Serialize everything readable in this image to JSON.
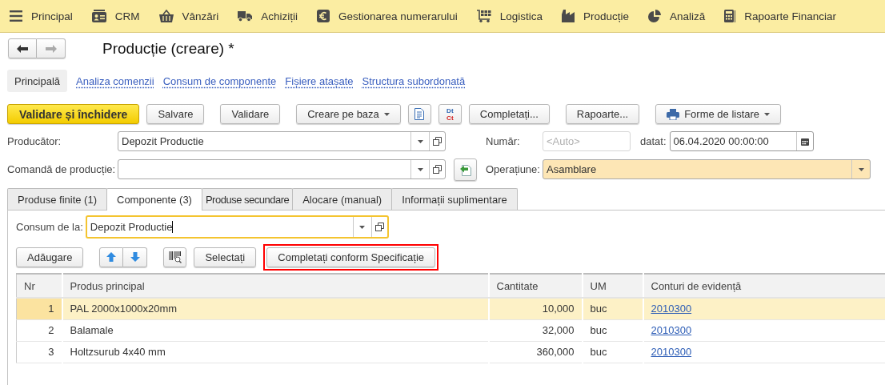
{
  "top_menu": [
    {
      "label": "Principal"
    },
    {
      "label": "CRM"
    },
    {
      "label": "Vânzări"
    },
    {
      "label": "Achiziții"
    },
    {
      "label": "Gestionarea numerarului"
    },
    {
      "label": "Logistica"
    },
    {
      "label": "Producție"
    },
    {
      "label": "Analiză"
    },
    {
      "label": "Rapoarte Financiar"
    }
  ],
  "window": {
    "title": "Producție (creare) *"
  },
  "sections": [
    {
      "label": "Principală",
      "selected": true
    },
    {
      "label": "Analiza comenzii",
      "selected": false
    },
    {
      "label": "Consum de componente",
      "selected": false
    },
    {
      "label": "Fișiere atașate",
      "selected": false
    },
    {
      "label": "Structura subordonată",
      "selected": false
    }
  ],
  "toolbar": [
    {
      "kind": "primary",
      "label": "Validare și închidere"
    },
    {
      "kind": "button",
      "label": "Salvare"
    },
    {
      "kind": "button",
      "label": "Validare"
    },
    {
      "kind": "menu",
      "label": "Creare pe baza"
    },
    {
      "kind": "report"
    },
    {
      "kind": "dtct",
      "labels": [
        "Dt",
        "Ct"
      ]
    },
    {
      "kind": "button",
      "label": "Completați..."
    },
    {
      "kind": "button",
      "label": "Rapoarte..."
    },
    {
      "kind": "print-menu",
      "label": "Forme de listare"
    }
  ],
  "producer": {
    "label": "Producător:",
    "value": "Depozit Productie"
  },
  "number": {
    "label": "Număr:",
    "placeholder": "<Auto>"
  },
  "date": {
    "label": "datat:",
    "value": "06.04.2020 00:00:00"
  },
  "order": {
    "label": "Comandă de producție:"
  },
  "operation": {
    "label": "Operațiune:",
    "value": "Asamblare"
  },
  "tabs": [
    {
      "label": "Produse finite (1)",
      "selected": false
    },
    {
      "label": "Componente (3)",
      "selected": true
    },
    {
      "label": "Produse secundare",
      "selected": false
    },
    {
      "label": "Alocare (manual)",
      "selected": false
    },
    {
      "label": "Informații suplimentare",
      "selected": false
    }
  ],
  "consumption": {
    "label": "Consum de la:",
    "value": "Depozit Productie",
    "focused": true
  },
  "table_toolbar": [
    {
      "kind": "button",
      "label": "Adăugare",
      "highlighted": false
    },
    {
      "kind": "arrows",
      "highlighted": false
    },
    {
      "kind": "barcode",
      "highlighted": false
    },
    {
      "kind": "button",
      "label": "Selectați",
      "highlighted": false
    },
    {
      "kind": "button",
      "label": "Completați conform Specificație",
      "highlighted": true
    }
  ],
  "table": {
    "columns": [
      "Nr",
      "Produs principal",
      "Cantitate",
      "UM",
      "Conturi de evidență"
    ],
    "rows": [
      {
        "nr": "1",
        "product": "PAL 2000x1000x20mm",
        "quantity": "10,000",
        "unit": "buc",
        "account": "2010300",
        "selected": true
      },
      {
        "nr": "2",
        "product": "Balamale",
        "quantity": "32,000",
        "unit": "buc",
        "account": "2010300",
        "selected": false
      },
      {
        "nr": "3",
        "product": "Holtzsurub 4x40 mm",
        "quantity": "360,000",
        "unit": "buc",
        "account": "2010300",
        "selected": false
      }
    ]
  }
}
